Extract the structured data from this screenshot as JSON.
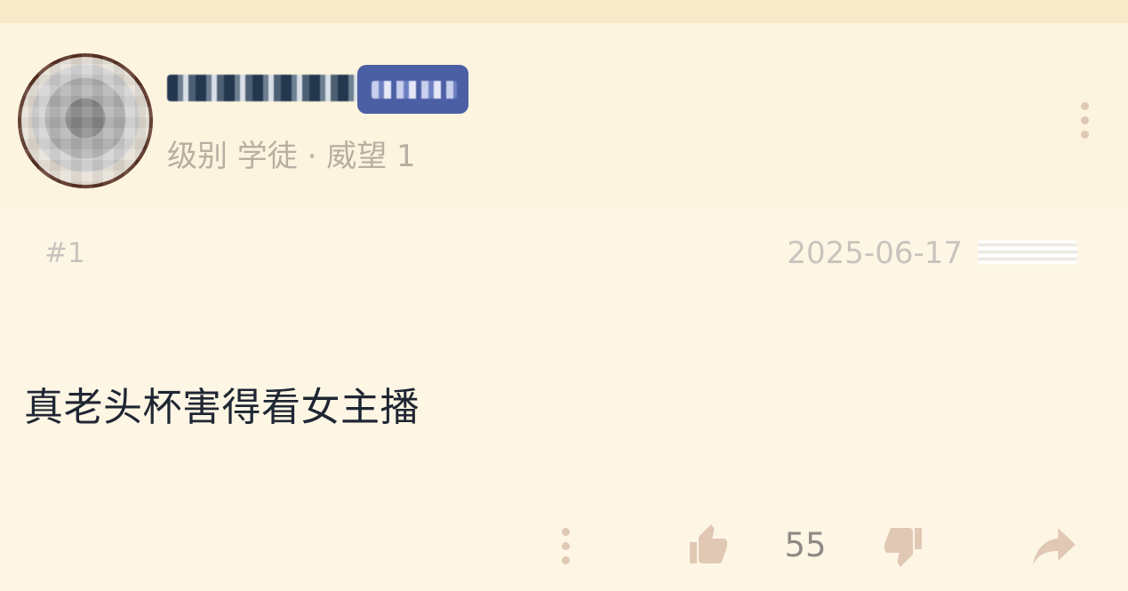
{
  "post": {
    "user": {
      "name": "",
      "meta": "级别 学徒 · 威望 1"
    },
    "floor": "#1",
    "date": "2025-06-17",
    "content": "真老头杯害得看女主播",
    "likes": "55"
  },
  "icons": {
    "header_more": "more-vertical-icon",
    "footer_more": "more-vertical-icon",
    "like": "thumb-up-icon",
    "dislike": "thumb-down-icon",
    "share": "share-icon"
  },
  "colors": {
    "background": "#fdf6e4",
    "text_primary": "#1f2633",
    "text_secondary": "#b8aea2",
    "icon": "#e0c8b5",
    "badge": "#4b5fa4"
  }
}
